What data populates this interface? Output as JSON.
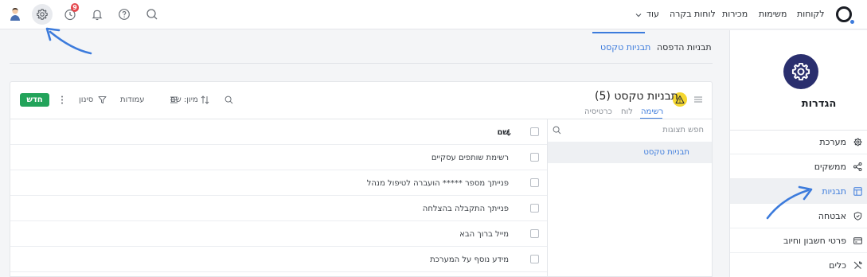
{
  "topbar": {
    "nav": [
      "לקוחות",
      "משימות",
      "מכירות",
      "לוחות בקרה",
      "עוד"
    ],
    "notifications_badge": "9",
    "icons": [
      "logo-icon",
      "chevron-down-icon",
      "search-icon",
      "help-icon",
      "bell-icon",
      "clock-icon",
      "gear-icon",
      "avatar"
    ]
  },
  "tabs": {
    "print_templates": "תבניות הדפסה",
    "text_templates": "תבניות טקסט"
  },
  "card": {
    "title": "תבניות טקסט (5)",
    "views": [
      "רשימה",
      "לוח",
      "כרטיסיה"
    ],
    "toolbar": {
      "sort": "מיון: שם",
      "columns": "עמודות",
      "filter": "סינון",
      "new": "חדש"
    },
    "column_header": "שם",
    "rows": [
      "רשימת שותפים עסקיים",
      "פנייתך מספר ***** הועברה לטיפול מנהל",
      "פנייתך התקבלה בהצלחה",
      "מייל ברוך הבא",
      "מידע נוסף על המערכת"
    ],
    "side_search_placeholder": "חפש תצוגות",
    "side_selected": "תבניות טקסט"
  },
  "panel": {
    "title": "הגדרות",
    "items": [
      "מערכת",
      "ממשקים",
      "תבניות",
      "אבטחה",
      "פרטי חשבון וחיוב",
      "כלים"
    ],
    "active_index": 2
  },
  "colors": {
    "accent": "#3c7bdc",
    "new_button": "#22a35a",
    "badge": "#e5484d",
    "settings_icon_bg": "#2a2f6e",
    "title_icon_bg": "#f5d730"
  }
}
